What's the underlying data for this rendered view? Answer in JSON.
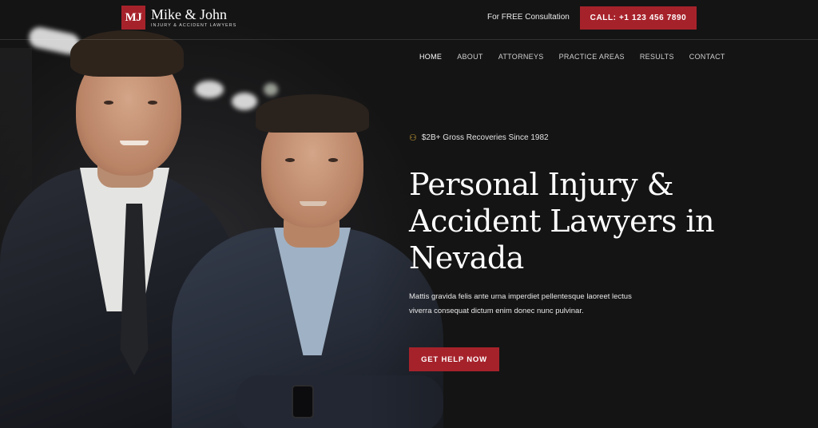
{
  "brand": {
    "mark": "MJ",
    "name": "Mike & John",
    "tagline": "INJURY & ACCIDENT LAWYERS",
    "accent_color": "#a6222b"
  },
  "header": {
    "consultation_text": "For FREE Consultation",
    "call_button_label": "CALL: +1 123 456 7890"
  },
  "nav": {
    "items": [
      "HOME",
      "ABOUT",
      "ATTORNEYS",
      "PRACTICE AREAS",
      "RESULTS",
      "CONTACT"
    ],
    "active": "HOME"
  },
  "hero": {
    "badge_icon": "medal-icon",
    "badge_text": "$2B+ Gross Recoveries Since 1982",
    "title": "Personal Injury & Accident Lawyers in Nevada",
    "description": "Mattis gravida felis ante urna imperdiet pellentesque laoreet lectus viverra consequat dictum enim donec nunc pulvinar.",
    "cta_label": "GET HELP NOW"
  }
}
